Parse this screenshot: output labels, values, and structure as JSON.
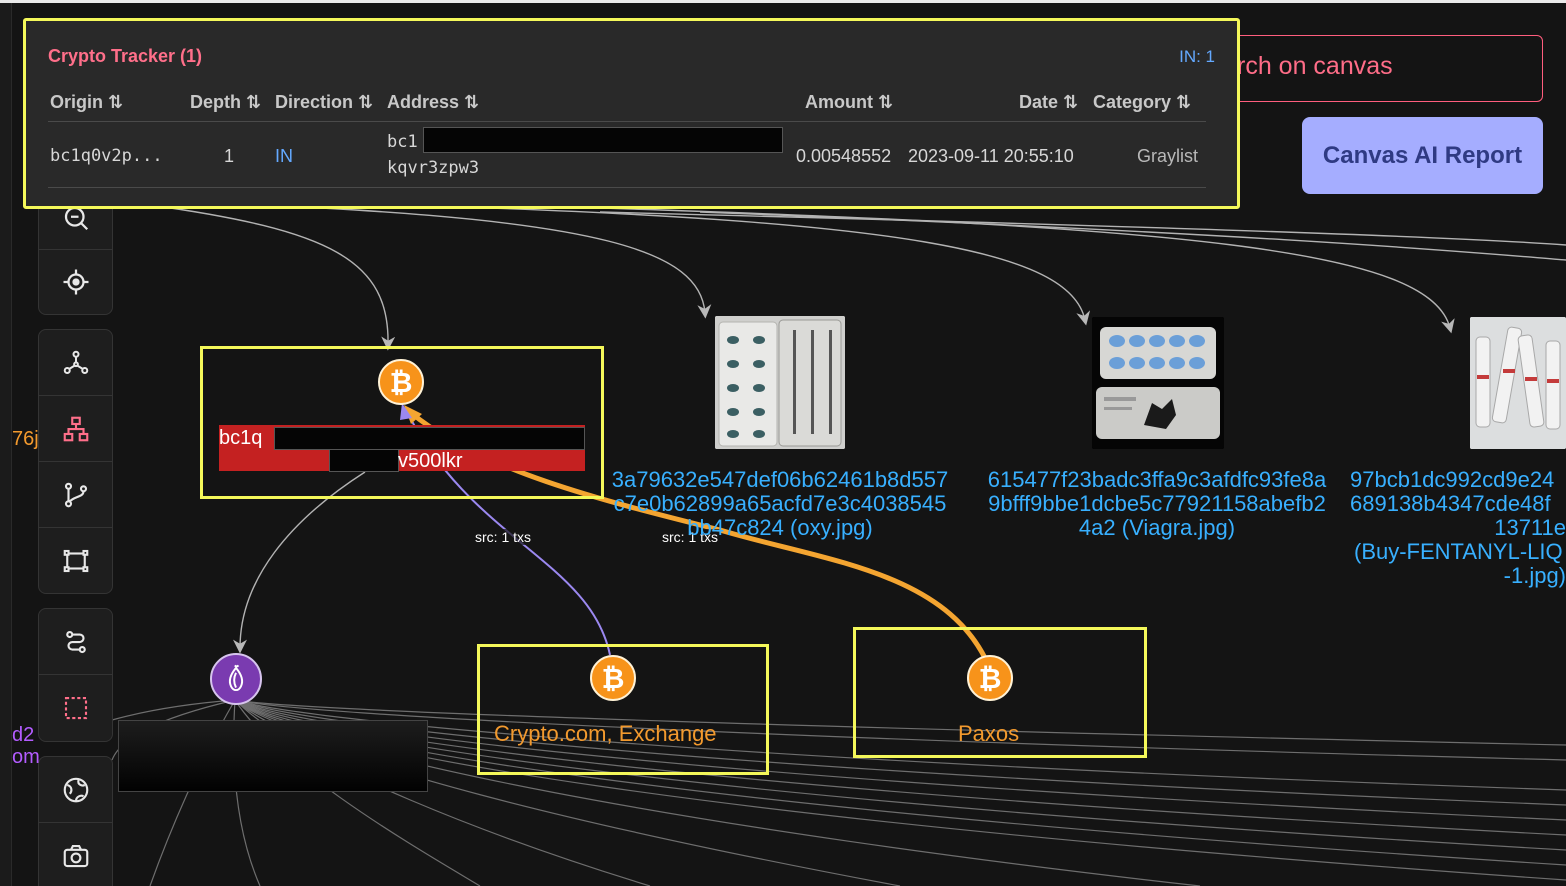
{
  "tracker": {
    "title": "Crypto Tracker (1)",
    "in_count": "IN: 1",
    "columns": [
      "Origin ⇅",
      "Depth ⇅",
      "Direction ⇅",
      "Address ⇅",
      "Amount ⇅",
      "Date ⇅",
      "Category ⇅"
    ],
    "rows": [
      {
        "origin": "bc1q0v2p...",
        "depth": "1",
        "direction": "IN",
        "address_line1": "bc1",
        "address_line2": "kqvr3zpw3",
        "amount": "0.00548552",
        "date": "2023-09-11 20:55:10",
        "category": "Graylist"
      }
    ]
  },
  "search": {
    "partial_text": "rch on canvas"
  },
  "ai_report": {
    "label": "Canvas AI Report"
  },
  "toolbar": {
    "icons": [
      "zoom-out-icon",
      "target-icon",
      "network-icon",
      "hierarchy-icon",
      "branch-icon",
      "frame-icon",
      "path-icon",
      "selection-icon",
      "globe-icon",
      "camera-icon"
    ]
  },
  "graph": {
    "main_node": {
      "label_start": "bc1q",
      "label_end": "v500lkr"
    },
    "exchange_node": {
      "label": "Crypto.com, Exchange"
    },
    "paxos_node": {
      "label": "Paxos"
    },
    "edges": [
      {
        "label": "src: 1 txs"
      },
      {
        "label": "src: 1 txs"
      }
    ],
    "images": [
      {
        "lines": [
          "3a79632e547def06b62461b8d557",
          "c7e0b62899a65acfd7e3c4038545",
          "bb47c824 (oxy.jpg)"
        ]
      },
      {
        "lines": [
          "615477f23badc3ffa9c3afdfc93fe8a",
          "9bfff9bbe1dcbe5c77921158abefb2",
          "4a2 (Viagra.jpg)"
        ]
      },
      {
        "lines": [
          "97bcb1dc992cd9e24",
          "689138b4347cde48f",
          "13711e",
          "(Buy-FENTANYL-LIQ",
          "-1.jpg)"
        ]
      }
    ],
    "left_fragments": {
      "frag1": "76j",
      "frag2": "d2",
      "frag3": "om"
    }
  },
  "colors": {
    "highlight": "#f4f85a",
    "accent_pink": "#ff6f8a",
    "link_blue": "#38b0ff",
    "btc_orange": "#f7931a",
    "edge_orange": "#f4a531",
    "edge_purple": "#9b88f0",
    "ai_button": "#a5adff"
  }
}
